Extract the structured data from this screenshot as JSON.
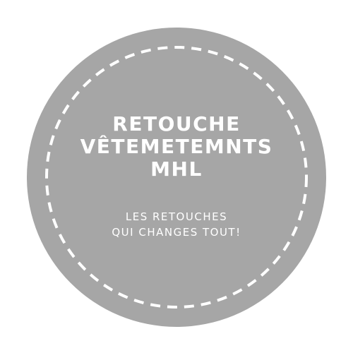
{
  "badge": {
    "fill_color": "#a6a6a6",
    "dash_color": "#ffffff",
    "title_lines": [
      "RETOUCHE",
      "VÊTEMETEMNTS",
      "MHL"
    ],
    "tagline_lines": [
      "LES RETOUCHES",
      "QUI CHANGES TOUT!"
    ]
  }
}
